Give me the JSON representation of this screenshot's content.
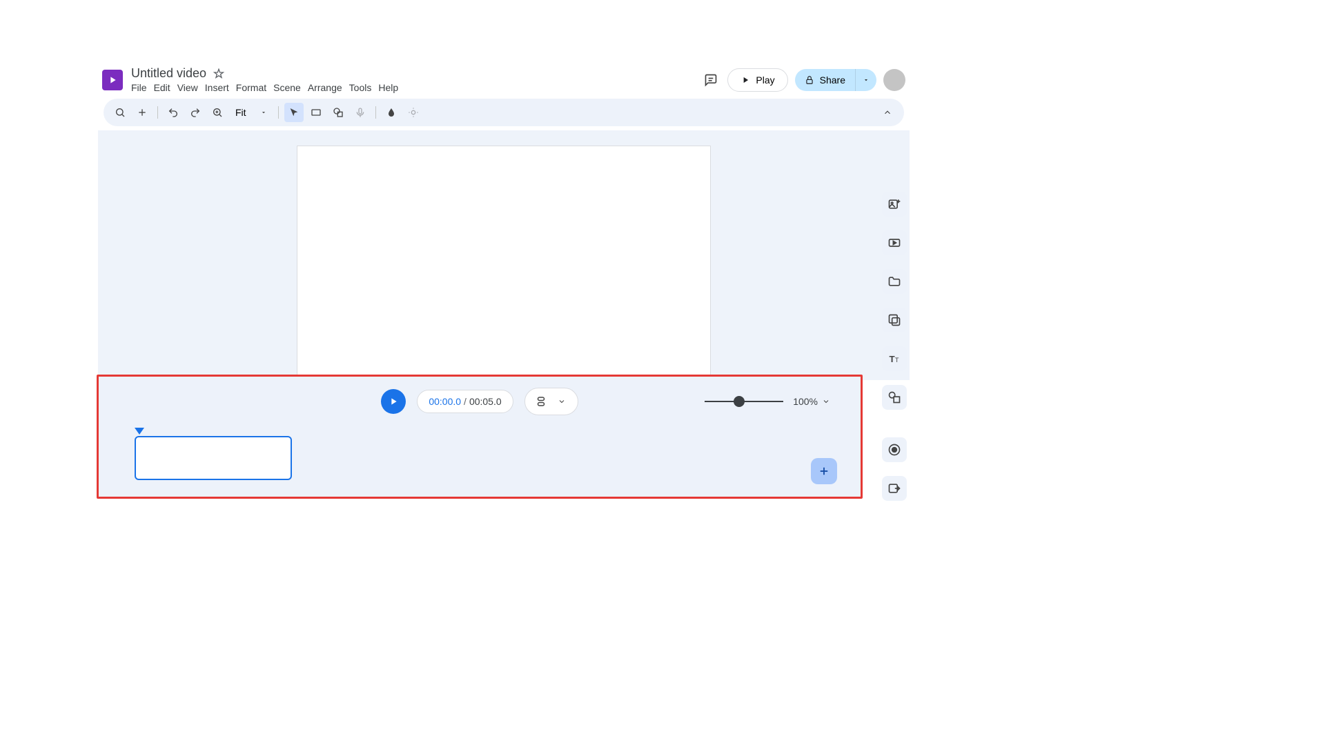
{
  "header": {
    "title": "Untitled video",
    "menu": [
      "File",
      "Edit",
      "View",
      "Insert",
      "Format",
      "Scene",
      "Arrange",
      "Tools",
      "Help"
    ],
    "play_label": "Play",
    "share_label": "Share"
  },
  "toolbar": {
    "zoom_mode": "Fit"
  },
  "timeline": {
    "current_time": "00:00.0",
    "separator": "/",
    "total_time": "00:05.0",
    "zoom_percent": "100%"
  }
}
